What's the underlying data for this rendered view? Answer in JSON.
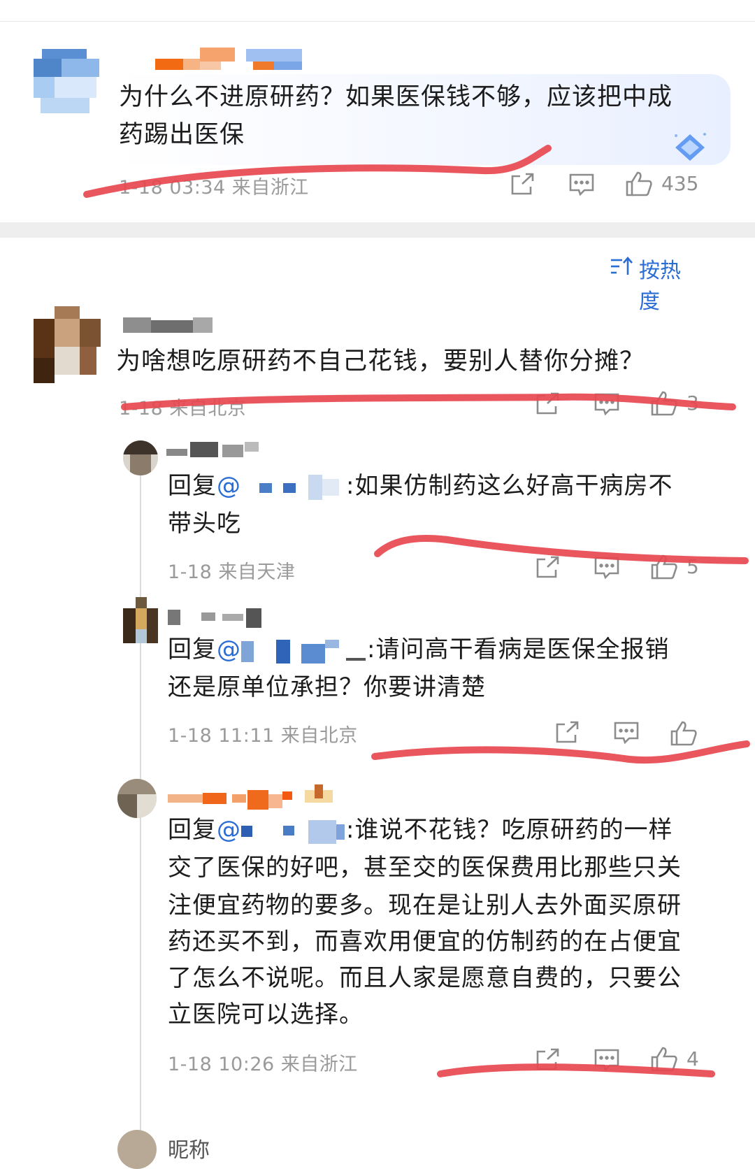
{
  "main_comment": {
    "text_line1": "为什么不进原研药？如果医保钱不够，应该把中成",
    "text_line2": "药踢出医保",
    "meta": "1-18 03:34  来自浙江",
    "likes": "435"
  },
  "sort": {
    "label": "按热度"
  },
  "comments": [
    {
      "text": "为啥想吃原研药不自己花钱，要别人替你分摊？",
      "meta": "1-18  来自北京",
      "likes": "3"
    }
  ],
  "replies": [
    {
      "prefix": "回复",
      "mention": "@",
      "text_line1": ":如果仿制药这么好高干病房不",
      "text_line2": "带头吃",
      "meta": "1-18  来自天津",
      "likes": "5"
    },
    {
      "prefix": "回复",
      "mention": "@",
      "text_line1": ":请问高干看病是医保全报销",
      "text_line2": "还是原单位承担？你要讲清楚",
      "meta": "1-18 11:11  来自北京",
      "likes": ""
    },
    {
      "prefix": "回复",
      "mention": "@",
      "text_line1": ":谁说不花钱？吃原研药的一样",
      "text_line2": "交了医保的好吧，甚至交的医保费用比那些只关",
      "text_line3": "注便宜药物的要多。现在是让别人去外面买原研",
      "text_line4": "药还买不到，而喜欢用便宜的仿制药的在占便宜",
      "text_line5": "了怎么不说呢。而且人家是愿意自费的，只要公",
      "text_line6": "立医院可以选择。",
      "meta": "1-18 10:26  来自浙江",
      "likes": "4"
    }
  ],
  "partial_next": {
    "name": "昵称"
  },
  "colors": {
    "accent": "#2a6dd4",
    "annotation": "#e8484f",
    "meta": "#9a9a9a"
  },
  "icons": [
    "share-icon",
    "comment-icon",
    "like-icon",
    "sort-icon",
    "diamond-badge-icon"
  ]
}
